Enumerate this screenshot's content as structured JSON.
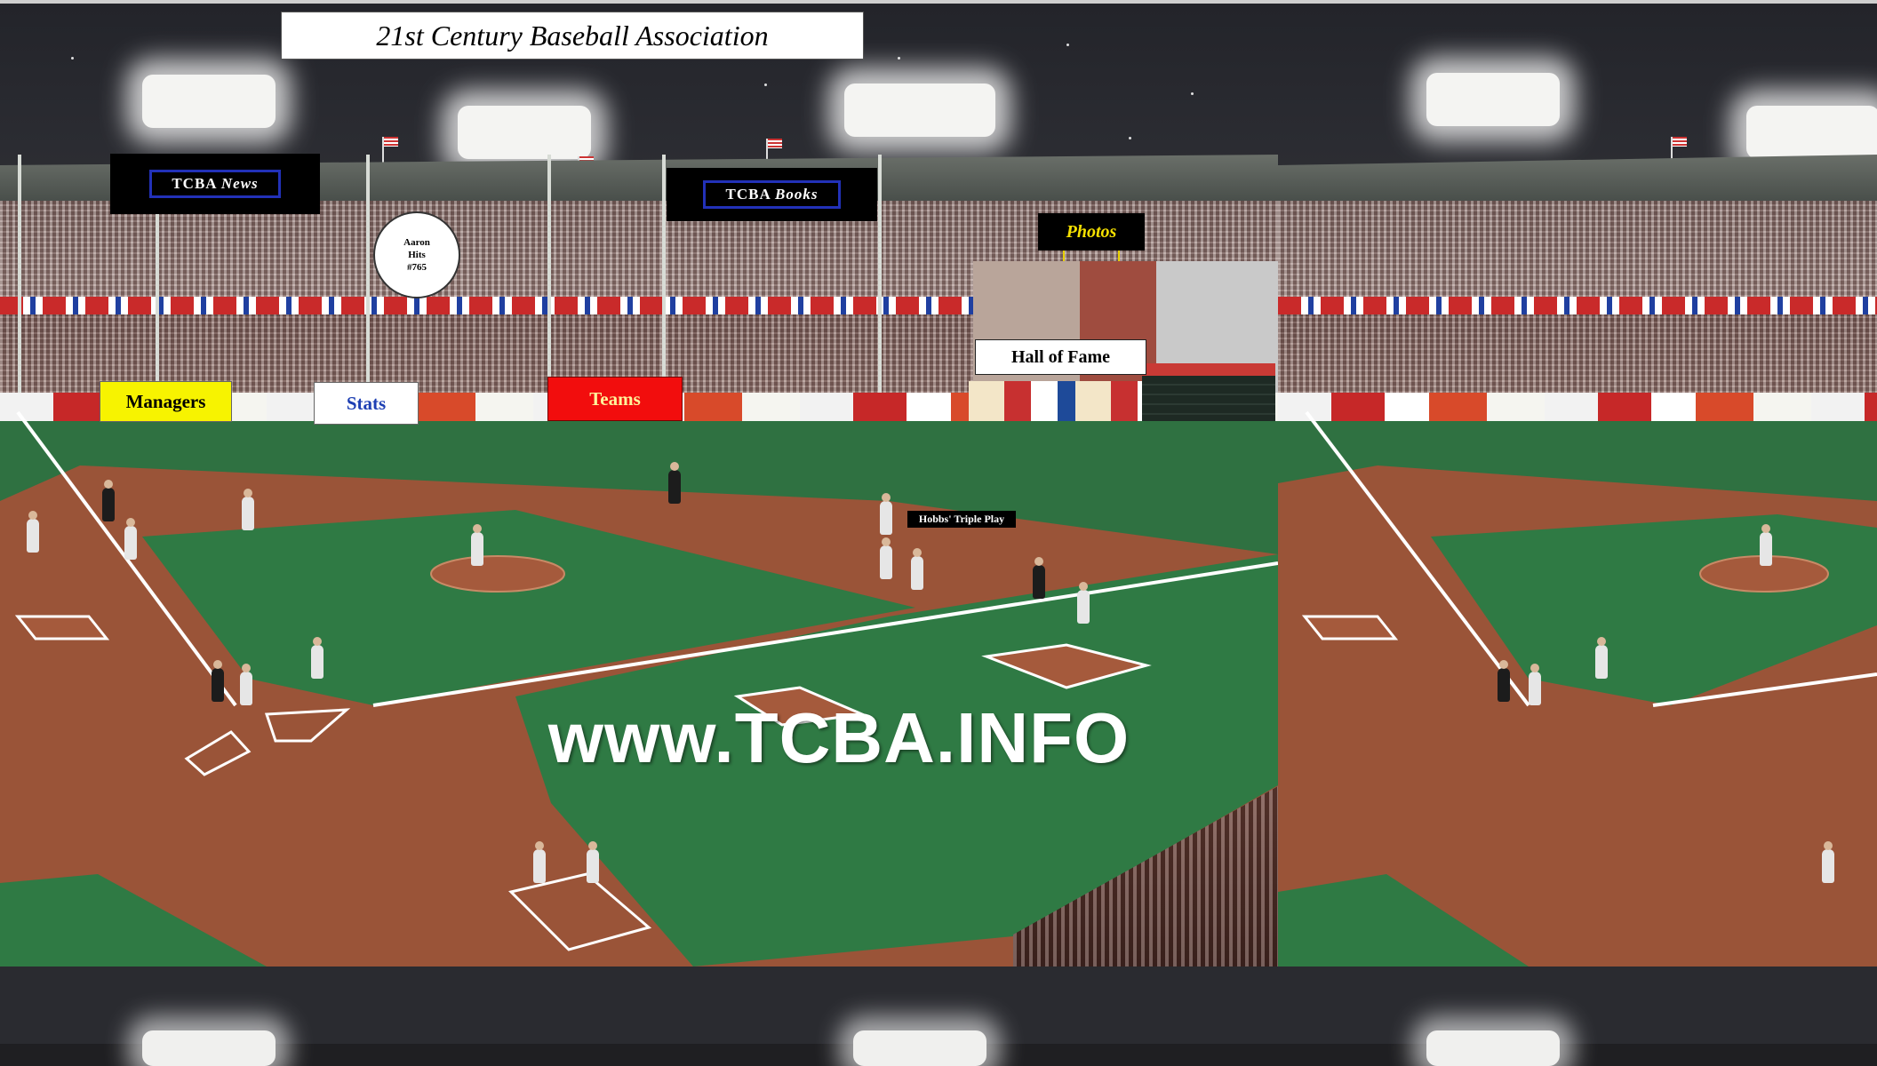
{
  "header": {
    "title": "21st Century Baseball Association"
  },
  "signs": {
    "news": {
      "prefix": "TCBA",
      "suffix": "News"
    },
    "books": {
      "prefix": "TCBA",
      "suffix": "Books"
    },
    "photos": "Photos",
    "hall_of_fame": "Hall of Fame",
    "aaron": [
      "Aaron",
      "Hits",
      "#765"
    ],
    "hobbs": "Hobbs' Triple Play"
  },
  "nav": {
    "managers": "Managers",
    "stats": "Stats",
    "teams": "Teams"
  },
  "site_url": "www.TCBA.INFO",
  "colors": {
    "managers_bg": "#f7f300",
    "stats_text": "#1d3fb3",
    "teams_bg": "#f20d0d",
    "sign_border": "#2231b8",
    "photos_text": "#f5e000"
  }
}
